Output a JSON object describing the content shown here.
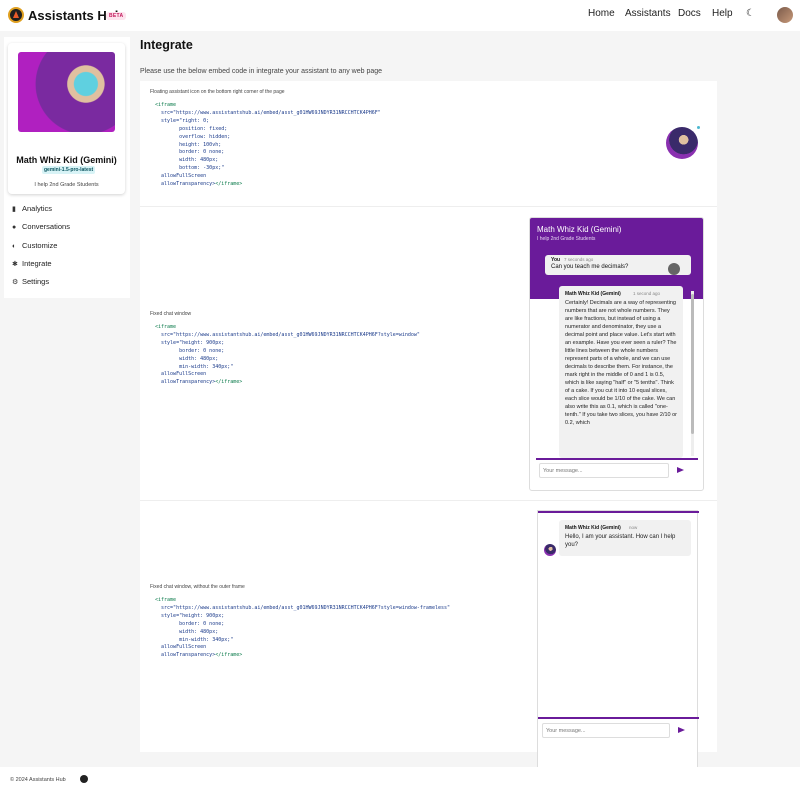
{
  "header": {
    "brand": "Assistants Hub",
    "beta": "BETA",
    "nav": [
      "Home",
      "Assistants",
      "Docs",
      "Help"
    ],
    "theme_icon": "moon-icon"
  },
  "sidebar": {
    "assistant_name": "Math Whiz Kid (Gemini)",
    "model": "gemini-1.5-pro-latest",
    "description": "I help 2nd Grade Students",
    "items": [
      {
        "label": "Analytics",
        "icon": "bar-chart-icon"
      },
      {
        "label": "Conversations",
        "icon": "chat-bubbles-icon"
      },
      {
        "label": "Customize",
        "icon": "palette-icon"
      },
      {
        "label": "Integrate",
        "icon": "puzzle-icon"
      },
      {
        "label": "Settings",
        "icon": "gear-icon"
      }
    ]
  },
  "main": {
    "title": "Integrate",
    "subtitle": "Please use the below embed code in integrate your assistant to any web page",
    "sections": [
      {
        "caption": "Floating assistant icon on the bottom right corner of the page",
        "code": [
          "<iframe",
          "  src=\"https://www.assistantshub.ai/embed/asst_g01HW69JNDYR31NRCCHTCK4PH6F\"",
          "  style=\"right: 0;",
          "        position: fixed;",
          "        overflow: hidden;",
          "        height: 100vh;",
          "        border: 0 none;",
          "        width: 480px;",
          "        bottom: -30px;\"",
          "  allowFullScreen",
          "  allowTransparency></iframe>"
        ]
      },
      {
        "caption": "Fixed chat window",
        "code": [
          "<iframe",
          "  src=\"https://www.assistantshub.ai/embed/asst_g01HW69JNDYR31NRCCHTCK4PH6F?style=window\"",
          "  style=\"height: 900px;",
          "        border: 0 none;",
          "        width: 480px;",
          "        min-width: 340px;\"",
          "  allowFullScreen",
          "  allowTransparency></iframe>"
        ]
      },
      {
        "caption": "Fixed chat window, without the outer frame",
        "code": [
          "<iframe",
          "  src=\"https://www.assistantshub.ai/embed/asst_g01HW69JNDYR31NRCCHTCK4PH6F?style=window-frameless\"",
          "  style=\"height: 900px;",
          "        border: 0 none;",
          "        width: 480px;",
          "        min-width: 340px;\"",
          "  allowFullScreen",
          "  allowTransparency></iframe>"
        ]
      }
    ]
  },
  "chat_window": {
    "title": "Math Whiz Kid (Gemini)",
    "subtitle": "I help 2nd Grade Students",
    "user_name": "You",
    "user_time": "7 seconds ago",
    "user_message": "Can you teach me decimals?",
    "bot_name": "Math Whiz Kid (Gemini)",
    "bot_time": "1 second ago",
    "bot_message": "Certainly! Decimals are a way of representing numbers that are not whole numbers. They are like fractions, but instead of using a numerator and denominator, they use a decimal point and place value. Let's start with an example. Have you ever seen a ruler? The little lines between the whole numbers represent parts of a whole, and we can use decimals to describe them. For instance, the mark right in the middle of 0 and 1 is 0.5, which is like saying \"half\" or \"5 tenths\". Think of a cake. If you cut it into 10 equal slices, each slice would be 1/10 of the cake. We can also write this as 0.1, which is called \"one-tenth.\" If you take two slices, you have 2/10 or 0.2, which",
    "input_placeholder": "Your message..."
  },
  "frameless_window": {
    "bot_name": "Math Whiz Kid (Gemini)",
    "bot_time": "now",
    "bot_message": "Hello, I am your assistant. How can I help you?",
    "input_placeholder": "Your message..."
  },
  "footer": {
    "copyright": "© 2024 Assistants Hub"
  },
  "colors": {
    "accent": "#6a1b9a",
    "model_badge_bg": "#d8f3f6"
  }
}
